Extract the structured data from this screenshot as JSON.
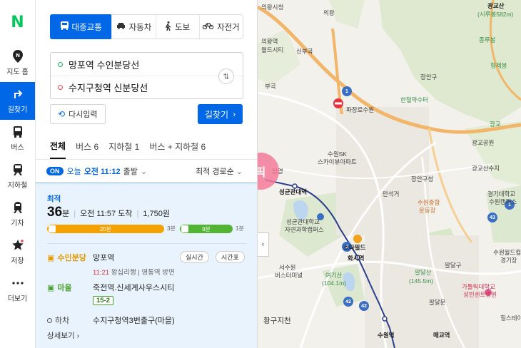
{
  "nav": {
    "logo": "N",
    "items": [
      {
        "label": "지도 홈",
        "icon": "map-pin-icon"
      },
      {
        "label": "길찾기",
        "icon": "turn-arrow-icon"
      },
      {
        "label": "버스",
        "icon": "bus-icon"
      },
      {
        "label": "지하철",
        "icon": "subway-icon"
      },
      {
        "label": "기차",
        "icon": "train-icon"
      },
      {
        "label": "저장",
        "icon": "star-icon"
      },
      {
        "label": "더보기",
        "icon": "more-dots-icon"
      }
    ]
  },
  "modes": [
    "대중교통",
    "자동차",
    "도보",
    "자전거"
  ],
  "route": {
    "origin": "망포역 수인분당선",
    "destination": "수지구청역 신분당선",
    "reset_label": "다시입력",
    "search_label": "길찾기"
  },
  "tabs": [
    "전체",
    "버스 6",
    "지하철 1",
    "버스 + 지하철 6"
  ],
  "departure": {
    "on_badge": "ON",
    "today": "오늘",
    "time": "오전 11:12",
    "suffix": "출발",
    "preference": "최적 경로순"
  },
  "result": {
    "best_label": "최적",
    "duration_num": "36",
    "duration_unit": "분",
    "arrival": "오전 11:57 도착",
    "fare": "1,750원",
    "segments": [
      {
        "mode": "subway",
        "label": "20분",
        "color": "#f5a200"
      },
      {
        "mode": "walk",
        "label": "3분"
      },
      {
        "mode": "bus",
        "label": "9분",
        "color": "#53b332"
      },
      {
        "mode": "walk",
        "label": "1분"
      }
    ],
    "legs": {
      "subway_line": "수인분당",
      "subway_station": "망포역",
      "subway_time": "11:21",
      "subway_detail": "왕십리행 | 영통역 방면",
      "chip_realtime": "실시간",
      "chip_timetable": "시간표",
      "bus_type": "마을",
      "bus_stop": "죽전역.신세계사우스시티",
      "bus_number": "15-2",
      "alight": "하차",
      "alight_stop": "수지구청역3번출구(마을)"
    },
    "more": "상세보기"
  },
  "map": {
    "labels": {
      "a": "의왕시청",
      "b": "의왕",
      "c": "광교산",
      "d": "(시루봉582m)",
      "e": "의왕역",
      "f": "월드시티",
      "g": "신부곡",
      "h": "부곡",
      "i": "파장로수원",
      "j": "광교공원",
      "k": "수원SK",
      "l": "스카이뷰아파트",
      "m": "장안구청",
      "n": "수원종합",
      "o": "운동장",
      "p": "장안구",
      "q": "만석거",
      "r": "성균관대역",
      "s": "성균관대학교",
      "t": "자연과학캠퍼스",
      "u": "스타필드",
      "v": "화서역",
      "w": "서수원",
      "x": "버스터미널",
      "y": "여기산",
      "z": "(104.1m)",
      "aa": "팔달산",
      "ab": "(145.5m)",
      "ac": "팔달구",
      "ad": "수원역",
      "ae": "매교역",
      "af": "황구지천",
      "ag": "경기대학교",
      "ah": "수원캠퍼스",
      "ai": "수원월드컵",
      "aj": "경기장",
      "ak": "가톨릭대학교",
      "al": "성빈센트병원",
      "am": "힐스테이트",
      "an": "광교산수지",
      "ao": "한철약수터",
      "ap": "종루봉",
      "aq": "광교",
      "ar": "형제봉",
      "as": "팔달문",
      "at": "월명"
    },
    "highway_numbers": [
      "1",
      "1",
      "42",
      "42",
      "43",
      "1"
    ],
    "pick_text": "픽"
  }
}
